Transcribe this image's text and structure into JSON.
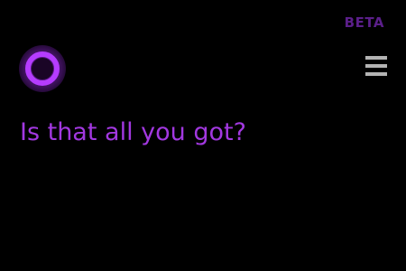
{
  "header": {
    "badge": "BETA"
  },
  "assistant": {
    "logo_icon": "cortana-ring-icon",
    "response": "Is that all you got?"
  },
  "menu": {
    "icon": "hamburger-menu-icon"
  },
  "colors": {
    "background": "#000000",
    "accent": "#a238e0",
    "badge": "#5b1f8a",
    "menu_icon": "#b3b3b3"
  }
}
